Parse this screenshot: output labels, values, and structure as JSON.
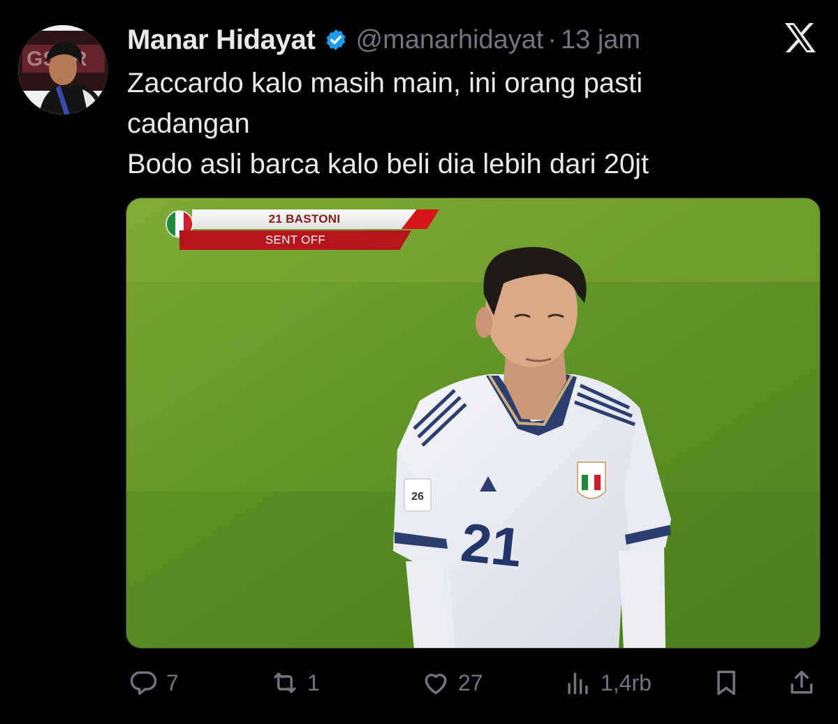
{
  "tweet": {
    "author_name": "Manar Hidayat",
    "handle": "@manarhidayat",
    "separator": "·",
    "time": "13 jam",
    "text_lines": [
      "Zaccardo kalo masih main, ini orang pasti",
      "cadangan",
      "Bodo asli barca kalo beli dia lebih dari 20jt"
    ]
  },
  "icons": {
    "verified": "verified-badge-icon",
    "platform": "x-logo-icon",
    "reply": "reply-icon",
    "repost": "repost-icon",
    "like": "heart-icon",
    "views": "views-icon",
    "bookmark": "bookmark-icon",
    "share": "share-icon"
  },
  "media": {
    "overlay_player": "21 BASTONI",
    "overlay_status": "SENT OFF",
    "jersey_number": "21"
  },
  "actions": {
    "replies": "7",
    "reposts": "1",
    "likes": "27",
    "views": "1,4rb"
  },
  "colors": {
    "background": "#000000",
    "primary_text": "#e7e9ea",
    "secondary_text": "#71767b",
    "verified_blue": "#1d9bf0",
    "overlay_red": "#b5161b"
  }
}
